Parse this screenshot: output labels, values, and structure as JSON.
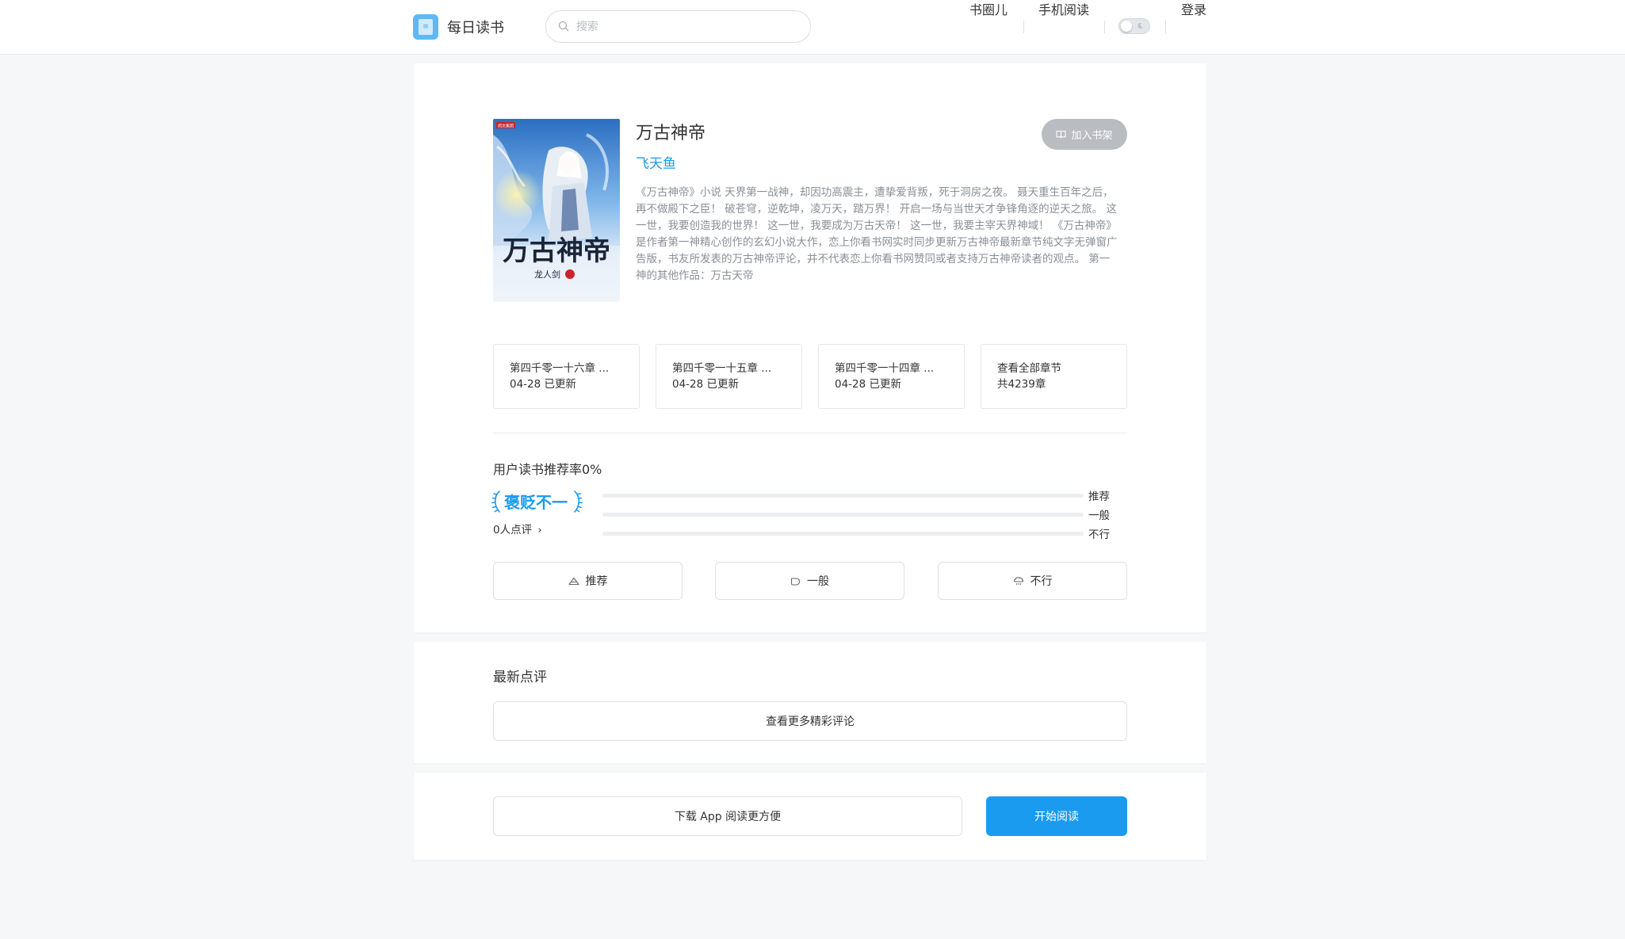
{
  "header": {
    "brand_name": "每日读书",
    "brand_logo_icon": "book-logo-icon",
    "search": {
      "placeholder": "搜索",
      "value": ""
    },
    "nav": {
      "circle": "书圈儿",
      "mobile": "手机阅读",
      "login": "登录"
    },
    "dark_mode_toggle": {
      "on": false,
      "icon": "moon-icon"
    }
  },
  "book": {
    "title": "万古神帝",
    "author": "飞天鱼",
    "add_to_shelf_label": "加入书架",
    "description": "《万古神帝》小说 天界第一战神，却因功高震主，遭挚爱背叛，死于洞房之夜。 聂天重生百年之后，再不做殿下之臣！ 破苍穹，逆乾坤，凌万天，踏万界！ 开启一场与当世天才争锋角逐的逆天之旅。 这一世，我要创造我的世界！ 这一世，我要成为万古天帝！ 这一世，我要主宰天界神域！ 《万古神帝》是作者第一神精心创作的玄幻小说大作，恋上你看书网实时同步更新万古神帝最新章节纯文字无弹窗广告版，书友所发表的万古神帝评论，并不代表恋上你看书网赞同或者支持万古神帝读者的观点。 第一神的其他作品：万古天帝",
    "cover": {
      "title_text": "万古神帝",
      "author_text": "龙人剑",
      "publisher_badge": "阅文集团"
    }
  },
  "chapters": [
    {
      "title": "第四千零一十六章 ...",
      "status": "04-28 已更新"
    },
    {
      "title": "第四千零一十五章 ...",
      "status": "04-28 已更新"
    },
    {
      "title": "第四千零一十四章 ...",
      "status": "04-28 已更新"
    },
    {
      "title": "查看全部章节",
      "status": "共4239章"
    }
  ],
  "rating": {
    "title": "用户读书推荐率0%",
    "badge": "褒贬不一",
    "review_count": "0人点评",
    "bars": [
      {
        "label": "推荐",
        "fraction": 0
      },
      {
        "label": "一般",
        "fraction": 0
      },
      {
        "label": "不行",
        "fraction": 0
      }
    ],
    "buttons": [
      {
        "label": "推荐",
        "icon": "thumbs-up-icon"
      },
      {
        "label": "一般",
        "icon": "neutral-hand-icon"
      },
      {
        "label": "不行",
        "icon": "thumbs-down-icon"
      }
    ]
  },
  "reviews": {
    "title": "最新点评",
    "more_label": "查看更多精彩评论"
  },
  "actions": {
    "download_label": "下载 App 阅读更方便",
    "read_label": "开始阅读"
  },
  "colors": {
    "accent": "#1a9bf0",
    "shelf_button": "#b9bcc1",
    "page_background": "#f6f7f9"
  }
}
